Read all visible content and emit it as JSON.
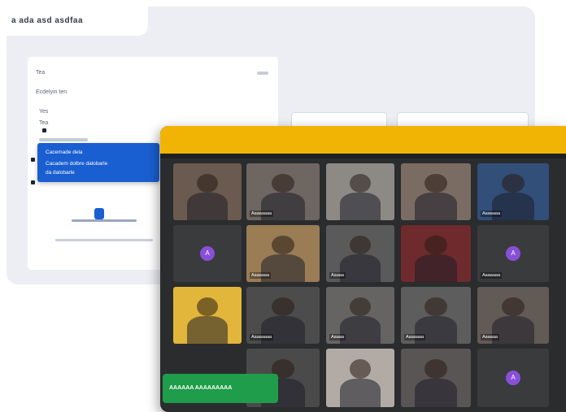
{
  "background_app": {
    "window_title": "a ada asd asdfaa",
    "panel_lines": [
      "Tea",
      "Ecdelyin ten",
      "Yes",
      "Tea"
    ],
    "context_menu": {
      "items": [
        "Cacemade dela",
        "Cacadem dolbre dalobarle",
        "da dalobarle"
      ]
    }
  },
  "meeting": {
    "participants": [
      {
        "name": "",
        "tone": "#6b5a4f"
      },
      {
        "name": "Aaaaaaaa",
        "tone": "#6e6660"
      },
      {
        "name": "",
        "tone": "#8d8a86"
      },
      {
        "name": "",
        "tone": "#7a6c63"
      },
      {
        "name": "Aaaaaaa",
        "tone": "#324f7a"
      },
      {
        "name": "",
        "tone": "#3a3b3d",
        "avatar": true,
        "initial": "A"
      },
      {
        "name": "Aaaaaaa",
        "tone": "#9a7c55"
      },
      {
        "name": "Aaaaa",
        "tone": "#5a5a5a"
      },
      {
        "name": "",
        "tone": "#6e2a2c"
      },
      {
        "name": "Aaaaaaa",
        "tone": "#3a3b3d",
        "avatar": true,
        "initial": "A"
      },
      {
        "name": "",
        "tone": "#e1b63a"
      },
      {
        "name": "Aaaaaaaa",
        "tone": "#4c4c4c"
      },
      {
        "name": "Aaaaa",
        "tone": "#666463"
      },
      {
        "name": "Aaaaaaa",
        "tone": "#5d5d5d"
      },
      {
        "name": "Aaaaaa",
        "tone": "#625a55"
      },
      {
        "name": "",
        "tone": "#4a4a4a"
      },
      {
        "name": "",
        "tone": "#b2aba5"
      },
      {
        "name": "",
        "tone": "#5a5555"
      },
      {
        "name": "",
        "tone": "#3a3b3d",
        "avatar": true,
        "initial": "A"
      }
    ],
    "share_banner": "AAAAAA AAAAAAAAA"
  },
  "colors": {
    "meeting_bar": "#f2b404",
    "context_menu": "#1a5fd1",
    "share_banner": "#1f9d4a"
  }
}
